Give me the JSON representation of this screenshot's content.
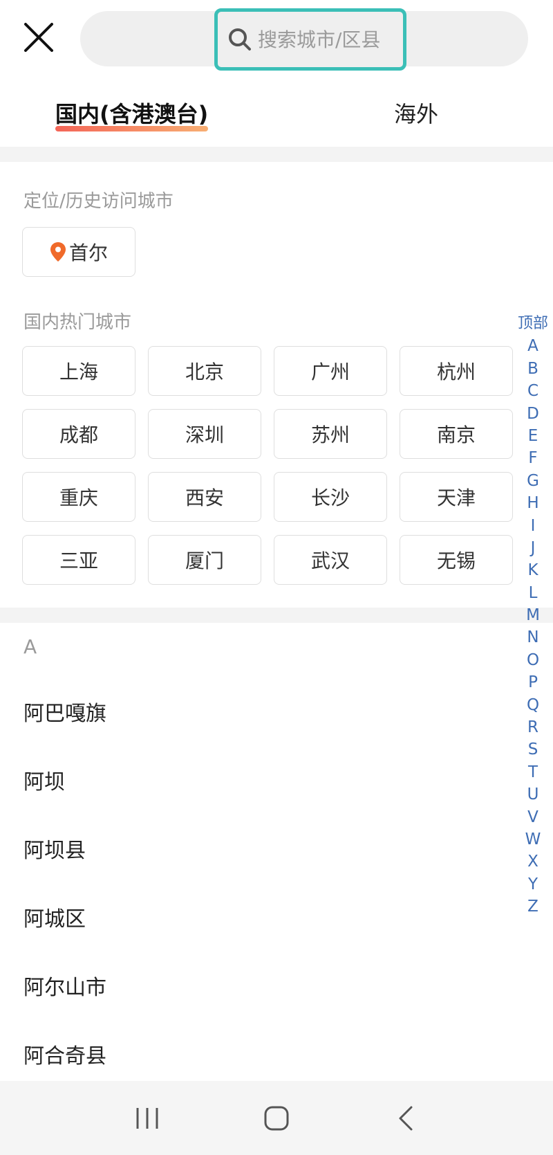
{
  "header": {
    "close_label": "",
    "search_placeholder": "搜索城市/区县"
  },
  "tabs": [
    {
      "label": "国内(含港澳台)",
      "active": true
    },
    {
      "label": "海外",
      "active": false
    }
  ],
  "location_section": {
    "label": "定位/历史访问城市",
    "current_city": "首尔"
  },
  "hot_section": {
    "label": "国内热门城市",
    "cities": [
      "上海",
      "北京",
      "广州",
      "杭州",
      "成都",
      "深圳",
      "苏州",
      "南京",
      "重庆",
      "西安",
      "长沙",
      "天津",
      "三亚",
      "厦门",
      "武汉",
      "无锡"
    ]
  },
  "index": {
    "top_label": "顶部",
    "letters": [
      "A",
      "B",
      "C",
      "D",
      "E",
      "F",
      "G",
      "H",
      "I",
      "J",
      "K",
      "L",
      "M",
      "N",
      "O",
      "P",
      "Q",
      "R",
      "S",
      "T",
      "U",
      "V",
      "W",
      "X",
      "Y",
      "Z"
    ]
  },
  "city_list": {
    "group": "A",
    "items": [
      "阿巴嘎旗",
      "阿坝",
      "阿坝县",
      "阿城区",
      "阿尔山市",
      "阿合奇县"
    ]
  },
  "colors": {
    "accent_focus": "#3bbfb7",
    "index_blue": "#3e6db4",
    "pin_orange": "#f06a2a"
  }
}
